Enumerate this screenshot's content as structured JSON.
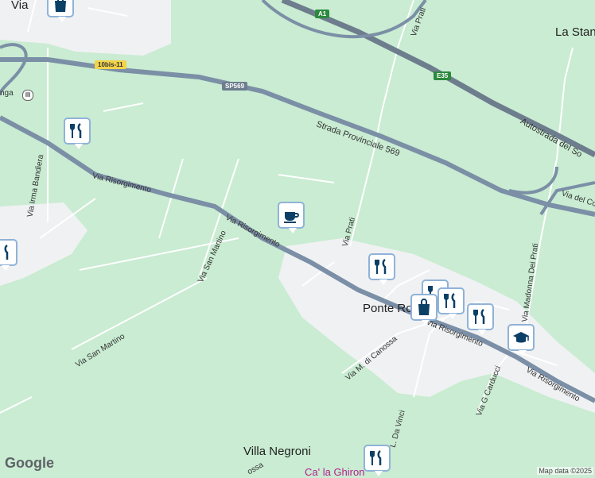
{
  "map": {
    "colors": {
      "green_area": "#c9ecd2",
      "urban": "#f0f1f3",
      "highway": "#7b8fa6",
      "road": "#ffffff",
      "marker_border": "#8fb3d8",
      "marker_icon": "#0b3f66"
    },
    "place_labels": {
      "via_top": "Via",
      "la_stanga": "La Stan",
      "ponte_rotto": "Ponte Ro",
      "villa_negroni": "Villa Negroni",
      "ca_la_ghirona": "Ca' la Ghiron",
      "station": "nga"
    },
    "road_labels": {
      "sp569": "Strada Provinciale 569",
      "risorgimento_1": "Via Risorgimento",
      "risorgimento_2": "Via Risorgimento",
      "risorgimento_3": "Via Risorgimento",
      "risorgimento_4": "Via Risorgimento",
      "irma_bandiera": "Via Irma Bandiera",
      "san_martino_1": "Via San Martino",
      "san_martino_2": "Via San Martino",
      "via_prati_1": "Via Prati",
      "via_prati_2": "Via Prati",
      "canossa": "Via M. di Canossa",
      "da_vinci": "L. Da Vinci",
      "carducci": "Via G Carducci",
      "madonna_prati": "Via Madonna Dei Prati",
      "autostrada": "Autostrada del So",
      "via_del_co": "Via del Co",
      "cossa": "ossa"
    },
    "shields": {
      "a1": "A1",
      "e35": "E35",
      "sp569": "SP569",
      "bis": "10bis-11"
    },
    "markers": [
      {
        "icon": "restaurant-icon"
      },
      {
        "icon": "coffee-icon"
      },
      {
        "icon": "restaurant-icon"
      },
      {
        "icon": "shopping-bag-icon"
      },
      {
        "icon": "restaurant-icon"
      },
      {
        "icon": "restaurant-icon"
      },
      {
        "icon": "school-icon"
      },
      {
        "icon": "restaurant-icon"
      },
      {
        "icon": "restaurant-icon"
      },
      {
        "icon": "shopping-bag-icon"
      }
    ],
    "branding": {
      "logo": "Google",
      "attribution": "Map data ©2025"
    }
  }
}
